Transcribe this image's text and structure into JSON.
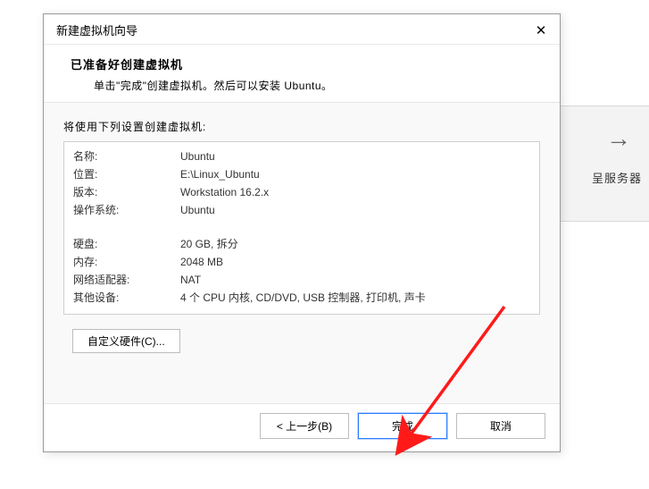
{
  "background": {
    "arrow_glyph": "→",
    "label_fragment": "呈服务器"
  },
  "dialog": {
    "title": "新建虚拟机向导",
    "header_title": "已准备好创建虚拟机",
    "header_subtitle": "单击\"完成\"创建虚拟机。然后可以安装 Ubuntu。",
    "settings_label": "将使用下列设置创建虚拟机:",
    "rows": [
      {
        "label": "名称:",
        "value": "Ubuntu"
      },
      {
        "label": "位置:",
        "value": "E:\\Linux_Ubuntu"
      },
      {
        "label": "版本:",
        "value": "Workstation 16.2.x"
      },
      {
        "label": "操作系统:",
        "value": "Ubuntu"
      }
    ],
    "rows2": [
      {
        "label": "硬盘:",
        "value": "20 GB, 拆分"
      },
      {
        "label": "内存:",
        "value": "2048 MB"
      },
      {
        "label": "网络适配器:",
        "value": "NAT"
      },
      {
        "label": "其他设备:",
        "value": "4 个 CPU 内核, CD/DVD, USB 控制器, 打印机, 声卡"
      }
    ],
    "customize_btn": "自定义硬件(C)...",
    "back_btn": "< 上一步(B)",
    "finish_btn": "完成",
    "cancel_btn": "取消"
  }
}
